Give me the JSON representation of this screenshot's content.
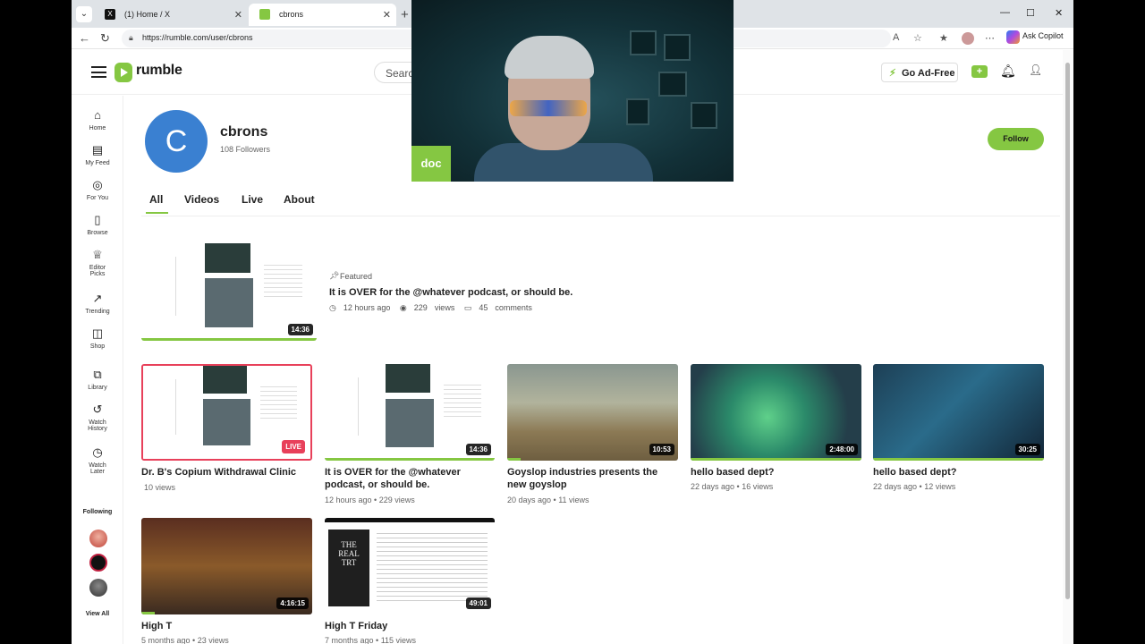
{
  "browser": {
    "tabs": [
      {
        "label": "(1) Home / X",
        "icon": "x-logo-icon"
      },
      {
        "label": "cbrons",
        "icon": "rumble-icon"
      }
    ],
    "url": "https://rumble.com/user/cbrons",
    "copilot_label": "Ask Copilot",
    "favicon_x": "X"
  },
  "header": {
    "logo": "rumble",
    "search_placeholder": "Search",
    "ad_free_label": "Go Ad-Free"
  },
  "sidebar": {
    "items": [
      {
        "label": "Home",
        "icon": "home-icon"
      },
      {
        "label": "My Feed",
        "icon": "feed-icon"
      },
      {
        "label": "For You",
        "icon": "target-icon"
      },
      {
        "label": "Browse",
        "icon": "browse-icon"
      },
      {
        "label": "Editor Picks",
        "icon": "trophy-icon"
      },
      {
        "label": "Trending",
        "icon": "trending-icon"
      },
      {
        "label": "Shop",
        "icon": "shop-icon"
      },
      {
        "label": "Library",
        "icon": "library-icon"
      },
      {
        "label": "Watch History",
        "icon": "history-icon"
      },
      {
        "label": "Watch Later",
        "icon": "clock-icon"
      }
    ],
    "following_heading": "Following",
    "view_all": "View All"
  },
  "channel": {
    "avatar_letter": "C",
    "name": "cbrons",
    "followers": "108 Followers",
    "follow_label": "Follow",
    "tabs": [
      "All",
      "Videos",
      "Live",
      "About"
    ]
  },
  "featured": {
    "label": "Featured",
    "title": "It is OVER for the @whatever podcast, or should be.",
    "time": "12 hours ago",
    "views": "229",
    "views_word": "views",
    "comments": "45",
    "comments_word": "comments",
    "duration": "14:36"
  },
  "videos": [
    {
      "title": "Dr. B's Copium Withdrawal Clinic",
      "meta": "10  views",
      "badge": "LIVE"
    },
    {
      "title": "It is OVER for the @whatever podcast, or should be.",
      "meta": "12 hours ago • 229  views",
      "duration": "14:36"
    },
    {
      "title": "Goyslop industries presents the new goyslop",
      "meta": "20 days ago • 11  views",
      "duration": "10:53"
    },
    {
      "title": "hello based dept?",
      "meta": "22 days ago • 16  views",
      "duration": "2:48:00"
    },
    {
      "title": "hello based dept?",
      "meta": "22 days ago • 12  views",
      "duration": "30:25"
    },
    {
      "title": "High T",
      "meta": "5 months ago • 23  views",
      "duration": "4:16:15"
    },
    {
      "title": "High T Friday",
      "meta": "7 months ago • 115  views",
      "duration": "49:01"
    }
  ],
  "webcam": {
    "badge": "doc"
  },
  "colors": {
    "brand_green": "#85c742",
    "live_red": "#e8405a",
    "avatar_blue": "#3a80d1"
  }
}
